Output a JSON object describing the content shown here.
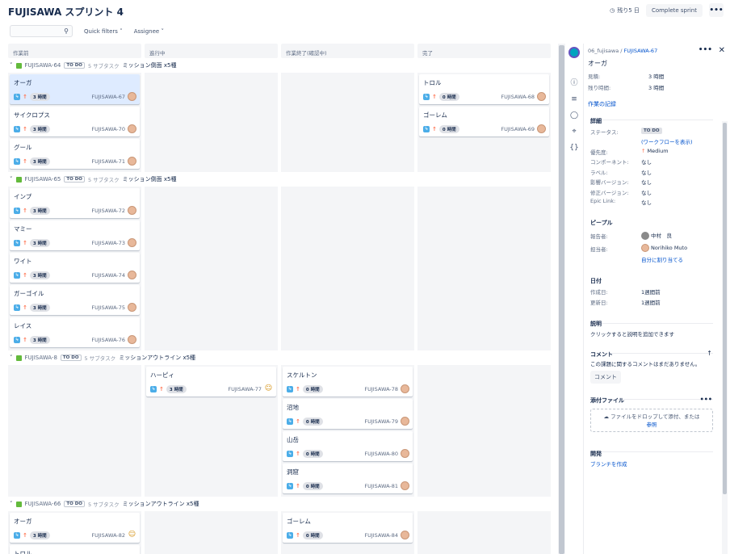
{
  "header": {
    "title": "FUJISAWA スプリント 4",
    "remaining": "残り5 日",
    "complete_label": "Complete sprint",
    "more_label": "•••"
  },
  "filters": {
    "search_placeholder": "",
    "quick_filters": "Quick filters",
    "assignee": "Assignee"
  },
  "columns": [
    "作業前",
    "進行中",
    "作業終了(確認中)",
    "完了"
  ],
  "lanes": [
    {
      "key": "FUJISAWA-64",
      "status": "TO DO",
      "subtasks": "5 サブタスク",
      "summary": "ミッション倒面 x5種",
      "cols": [
        [
          {
            "title": "オーガ",
            "est": "3 時間",
            "key": "FUJISAWA-67",
            "selected": true,
            "av": "face"
          },
          {
            "title": "サイクロプス",
            "est": "3 時間",
            "key": "FUJISAWA-70",
            "av": "face"
          },
          {
            "title": "グール",
            "est": "3 時間",
            "key": "FUJISAWA-71",
            "av": "face"
          }
        ],
        [],
        [],
        [
          {
            "title": "トロル",
            "est": "0 時間",
            "key": "FUJISAWA-68",
            "av": "face"
          },
          {
            "title": "ゴーレム",
            "est": "0 時間",
            "key": "FUJISAWA-69",
            "av": "face"
          }
        ]
      ]
    },
    {
      "key": "FUJISAWA-65",
      "status": "TO DO",
      "subtasks": "5 サブタスク",
      "summary": "ミッション倒面 x5種",
      "cols": [
        [
          {
            "title": "インプ",
            "est": "3 時間",
            "key": "FUJISAWA-72",
            "av": "face"
          },
          {
            "title": "マミー",
            "est": "3 時間",
            "key": "FUJISAWA-73",
            "av": "face"
          },
          {
            "title": "ワイト",
            "est": "3 時間",
            "key": "FUJISAWA-74",
            "av": "face"
          },
          {
            "title": "ガーゴイル",
            "est": "3 時間",
            "key": "FUJISAWA-75",
            "av": "face"
          },
          {
            "title": "レイス",
            "est": "3 時間",
            "key": "FUJISAWA-76",
            "av": "face"
          }
        ],
        [],
        [],
        []
      ]
    },
    {
      "key": "FUJISAWA-8",
      "status": "TO DO",
      "subtasks": "5 サブタスク",
      "summary": "ミッションアウトライン x5種",
      "cols": [
        [],
        [
          {
            "title": "ハーピィ",
            "est": "3 時間",
            "key": "FUJISAWA-77",
            "av": "emoji"
          }
        ],
        [
          {
            "title": "スケルトン",
            "est": "0 時間",
            "key": "FUJISAWA-78",
            "av": "face"
          },
          {
            "title": "沼地",
            "est": "0 時間",
            "key": "FUJISAWA-79",
            "av": "face"
          },
          {
            "title": "山岳",
            "est": "0 時間",
            "key": "FUJISAWA-80",
            "av": "face"
          },
          {
            "title": "洞窟",
            "est": "0 時間",
            "key": "FUJISAWA-81",
            "av": "face"
          }
        ],
        []
      ]
    },
    {
      "key": "FUJISAWA-66",
      "status": "TO DO",
      "subtasks": "5 サブタスク",
      "summary": "ミッションアウトライン x5種",
      "cols": [
        [
          {
            "title": "オーガ",
            "est": "3 時間",
            "key": "FUJISAWA-82",
            "av": "emoji"
          },
          {
            "title": "トロル",
            "est": "",
            "key": "",
            "av": "none"
          }
        ],
        [],
        [
          {
            "title": "ゴーレム",
            "est": "0 時間",
            "key": "FUJISAWA-84",
            "av": "face"
          }
        ],
        []
      ]
    }
  ],
  "panel": {
    "crumb_parent": "06_fujisawa /",
    "crumb_key": "FUJISAWA-67",
    "issue_title": "オーガ",
    "estimate_label": "見積:",
    "estimate_value": "3 時間",
    "remaining_label": "残り時間:",
    "remaining_value": "3 時間",
    "worklog": "作業の記録",
    "details": "詳細",
    "status_label": "ステータス:",
    "status_value": "TO DO",
    "workflow": "(ワークフローを表示)",
    "priority_label": "優先度:",
    "priority_value": "Medium",
    "component_label": "コンポーネント:",
    "component_value": "なし",
    "label_label": "ラベル:",
    "label_value": "なし",
    "affects_label": "影響バージョン:",
    "affects_value": "なし",
    "fix_label": "修正バージョン:",
    "fix_value": "なし",
    "epic_label": "Epic Link:",
    "epic_value": "なし",
    "people": "ピープル",
    "reporter_label": "報告者:",
    "reporter_value": "中村　良",
    "assignee_label": "担当者:",
    "assignee_value": "Norihiko Muto",
    "assign_me": "自分に割り当てる",
    "dates": "日付",
    "created_label": "作成日:",
    "created_value": "1週間前",
    "updated_label": "更新日:",
    "updated_value": "1週間前",
    "desc_title": "説明",
    "desc_text": "クリックすると説明を追加できます",
    "comment_title": "コメント",
    "comment_text": "この課題に関するコメントはまだありません。",
    "comment_btn": "コメント",
    "attach_title": "添付ファイル",
    "attach_more": "•••",
    "drop_text": "ファイルをドロップして添付、または",
    "browse": "参照",
    "dev_title": "開発",
    "branch": "ブランチを作成"
  }
}
